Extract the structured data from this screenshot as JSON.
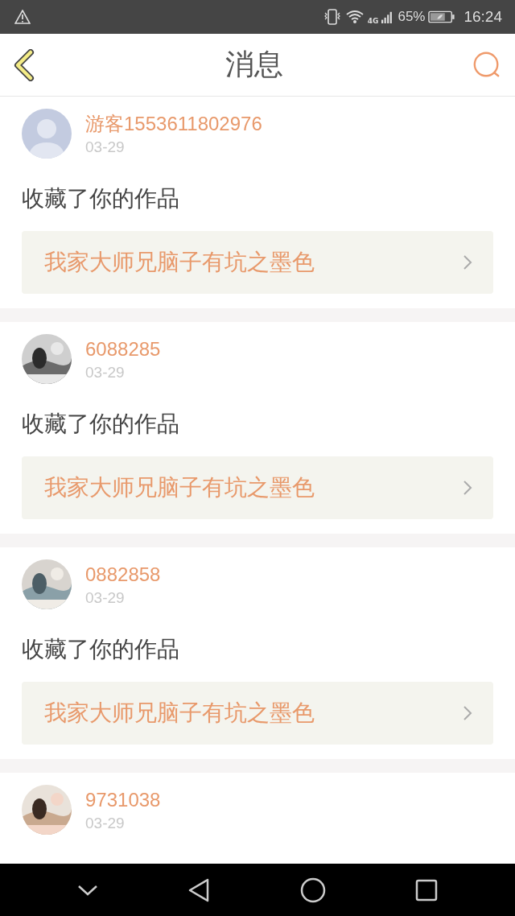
{
  "status_bar": {
    "battery_text": "65%",
    "network_label": "4G",
    "time": "16:24"
  },
  "header": {
    "title": "消息"
  },
  "messages": [
    {
      "avatar": {
        "kind": "default"
      },
      "user": "游客1553611802976",
      "date": "03-29",
      "action": "收藏了你的作品",
      "work": "我家大师兄脑子有坑之墨色"
    },
    {
      "user": "6088285",
      "date": "03-29",
      "action": "收藏了你的作品",
      "work": "我家大师兄脑子有坑之墨色"
    },
    {
      "user": "0882858",
      "date": "03-29",
      "action": "收藏了你的作品",
      "work": "我家大师兄脑子有坑之墨色"
    },
    {
      "user": "9731038",
      "date": "03-29"
    }
  ]
}
